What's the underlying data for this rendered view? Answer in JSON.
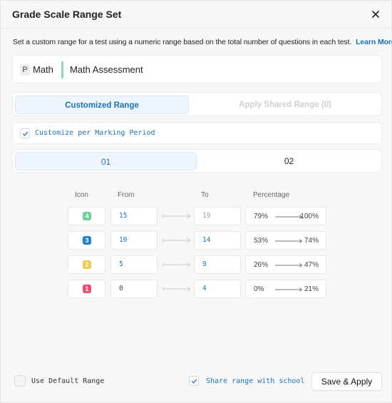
{
  "dialog": {
    "title": "Grade Scale Range Set",
    "description": "Set a custom range for a test using a numeric range based on the total number of questions in each test.",
    "learn_more": "Learn More"
  },
  "subject": {
    "badge": "P",
    "name": "Math",
    "assessment": "Math Assessment"
  },
  "tabs": [
    {
      "label": "Customized Range",
      "active": true
    },
    {
      "label": "Apply Shared Range (0)",
      "active": false,
      "disabled": true
    }
  ],
  "customize": {
    "label": "Customize per Marking Period",
    "checked": true
  },
  "periods": [
    {
      "label": "01",
      "active": true
    },
    {
      "label": "02",
      "active": false
    }
  ],
  "table": {
    "headers": {
      "icon": "Icon",
      "from": "From",
      "to": "To",
      "percentage": "Percentage"
    },
    "rows": [
      {
        "icon": "4",
        "icon_color": "#6fcf97",
        "from": "15",
        "to": "19",
        "pct_from": "79%",
        "pct_to": "100%"
      },
      {
        "icon": "3",
        "icon_color": "#1f7fd0",
        "from": "10",
        "to": "14",
        "pct_from": "53%",
        "pct_to": "74%"
      },
      {
        "icon": "2",
        "icon_color": "#f2c94c",
        "from": "5",
        "to": "9",
        "pct_from": "26%",
        "pct_to": "47%"
      },
      {
        "icon": "1",
        "icon_color": "#eb4d6d",
        "from": "0",
        "to": "4",
        "pct_from": "0%",
        "pct_to": "21%"
      }
    ]
  },
  "footer": {
    "default_range_label": "Use Default Range",
    "default_range_checked": false,
    "share_label": "Share range with school",
    "share_checked": true,
    "save_label": "Save & Apply"
  },
  "colors": {
    "accent": "#1a73b8",
    "accent_bg": "#eef5fc",
    "subject_bar": "#8dd3c4"
  }
}
